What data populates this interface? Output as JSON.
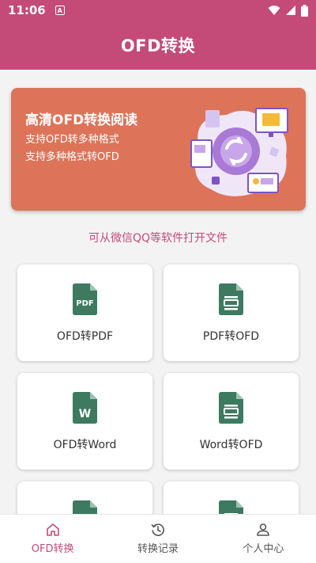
{
  "status_bar": {
    "time": "11:06",
    "app_badge": "A"
  },
  "app_bar": {
    "title": "OFD转换"
  },
  "banner": {
    "title": "高清OFD转换阅读",
    "line1": "支持OFD转多种格式",
    "line2": "支持多种格式转OFD"
  },
  "hint": "可从微信QQ等软件打开文件",
  "cards": [
    {
      "label": "OFD转PDF",
      "icon": "pdf-file-icon"
    },
    {
      "label": "PDF转OFD",
      "icon": "ofd-file-icon"
    },
    {
      "label": "OFD转Word",
      "icon": "word-file-icon"
    },
    {
      "label": "Word转OFD",
      "icon": "ofd-file-icon"
    }
  ],
  "bottom_nav": [
    {
      "label": "OFD转换",
      "icon": "home-icon",
      "active": true
    },
    {
      "label": "转换记录",
      "icon": "history-icon",
      "active": false
    },
    {
      "label": "个人中心",
      "icon": "person-icon",
      "active": false
    }
  ],
  "colors": {
    "accent": "#c44a78",
    "banner": "#dd7459",
    "doc_green": "#3d7a60"
  }
}
